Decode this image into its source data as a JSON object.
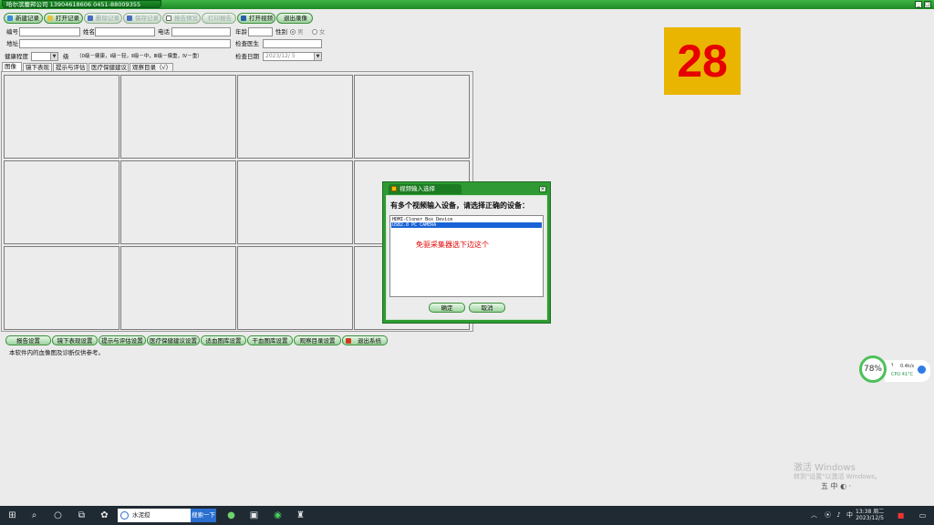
{
  "app": {
    "title": "哈尔滨蕾邦公司   13904618606    0451-88009355"
  },
  "toolbar": {
    "buttons": [
      {
        "label": "新建记录",
        "enabled": true
      },
      {
        "label": "打开记录",
        "enabled": true
      },
      {
        "label": "删除记录",
        "enabled": false
      },
      {
        "label": "保存记录",
        "enabled": false
      },
      {
        "label": "报告预览",
        "enabled": false
      },
      {
        "label": "打印报告",
        "enabled": false
      },
      {
        "label": "打开视频",
        "enabled": true
      },
      {
        "label": "退出录像",
        "enabled": true
      }
    ]
  },
  "form": {
    "id_label": "编号",
    "name_label": "姓名",
    "phone_label": "电话",
    "age_label": "年龄",
    "sex_label": "性别",
    "sex_male": "男",
    "sex_female": "女",
    "address_label": "地址",
    "doctor_label": "检查医生",
    "health_label": "健康程度",
    "health_unit": "级",
    "health_hint": "（0级－健康，Ⅰ级－轻，Ⅱ级－中，Ⅲ级－偏重，Ⅳ－重）",
    "date_label": "检查日期",
    "date_value": "2023/12/ 5"
  },
  "tabs": [
    "图像",
    "镜下表现",
    "提示与评估",
    "医疗保健建议",
    "观察目录（√）"
  ],
  "bottom_buttons": [
    "报告设置",
    "镜下表现设置",
    "提示与评估设置",
    "医疗保健建议设置",
    "适血图库设置",
    "干血图库设置",
    "观察目录设置",
    "退出系统"
  ],
  "note": "本软件内的血像图及诊断仅供参考。",
  "badge": "28",
  "dialog": {
    "title": "视频输入选择",
    "message": "有多个视频输入设备，请选择正确的设备：",
    "devices": [
      "HDMI-Cloner Box Device",
      "USB2.0 PC CAMERA"
    ],
    "selected_index": 1,
    "annotation": "免驱采集器选下边这个",
    "ok": "确定",
    "cancel": "取消"
  },
  "widget": {
    "percent": "78%",
    "net": "0.4k/s",
    "cpu": "CPU 41°C"
  },
  "watermark": {
    "line1": "激活 Windows",
    "line2": "转到\"设置\"以激活 Windows。",
    "ime": "五 中 ◐ ·"
  },
  "taskbar": {
    "search_value": "水泥搅",
    "search_button": "搜索一下",
    "time": "13:38 周二",
    "date": "2023/12/5"
  }
}
